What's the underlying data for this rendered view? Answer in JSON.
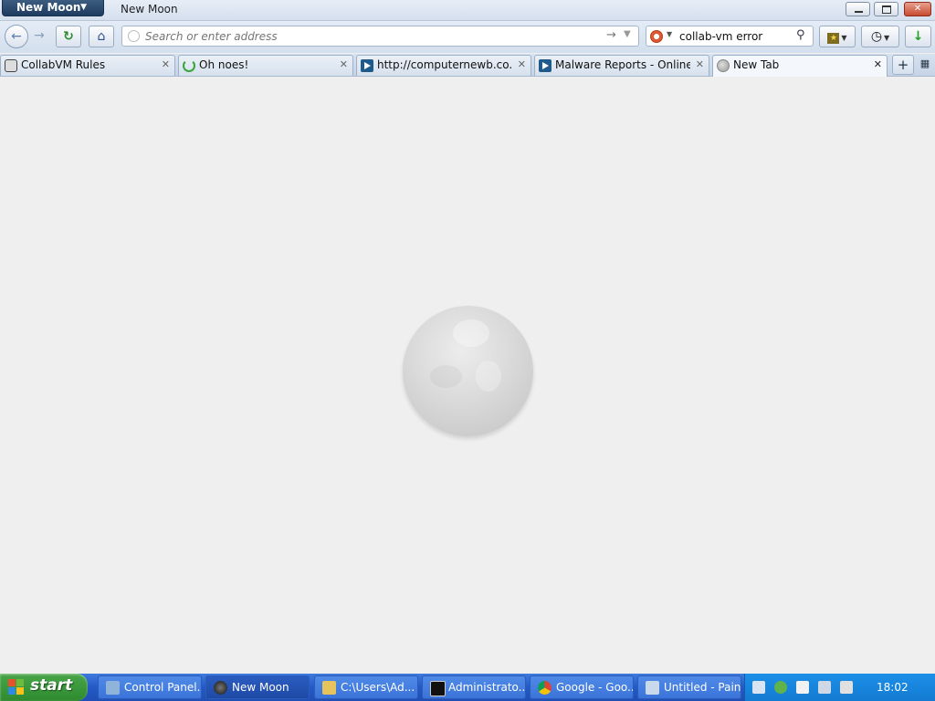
{
  "window": {
    "app_menu_label": "New Moon",
    "title": "New Moon"
  },
  "navbar": {
    "url_placeholder": "Search or enter address",
    "search_value": "collab-vm error"
  },
  "tabs": [
    {
      "label": "CollabVM Rules",
      "icon": "rules-icon"
    },
    {
      "label": "Oh noes!",
      "icon": "loading-spinner-icon"
    },
    {
      "label": "http://computernewb.co...",
      "icon": "play-icon"
    },
    {
      "label": "Malware Reports - Online ...",
      "icon": "play-icon"
    },
    {
      "label": "New Tab",
      "icon": "globe-icon",
      "selected": true
    }
  ],
  "taskbar": {
    "start_label": "start",
    "items": [
      {
        "label": "Control Panel..."
      },
      {
        "label": "New Moon"
      },
      {
        "label": "C:\\Users\\Ad..."
      },
      {
        "label": "Administrato..."
      },
      {
        "label": "Google - Goo..."
      },
      {
        "label": "Untitled - Paint"
      }
    ],
    "clock": "18:02"
  },
  "colors": {
    "taskbar_blue": "#2459c6",
    "start_green": "#2f8a2f",
    "tray_blue": "#137bd1",
    "content_bg": "#efefef"
  }
}
